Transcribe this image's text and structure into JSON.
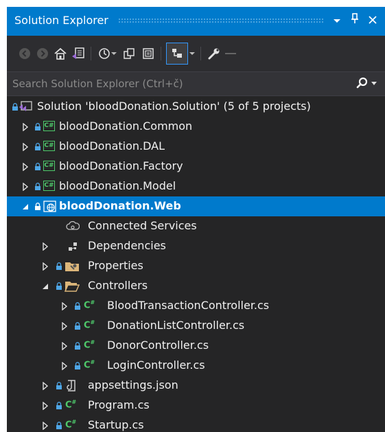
{
  "window": {
    "title": "Solution Explorer"
  },
  "search": {
    "placeholder": "Search Solution Explorer (Ctrl+č)"
  },
  "tree": {
    "solution": "Solution 'bloodDonation.Solution' (5 of 5 projects)",
    "projects": [
      "bloodDonation.Common",
      "bloodDonation.DAL",
      "bloodDonation.Factory",
      "bloodDonation.Model"
    ],
    "web_project": "bloodDonation.Web",
    "web_children": {
      "connected_services": "Connected Services",
      "dependencies": "Dependencies",
      "properties": "Properties",
      "controllers": "Controllers",
      "controller_files": [
        "BloodTransactionController.cs",
        "DonationListController.cs",
        "DonorController.cs",
        "LoginController.cs"
      ],
      "appsettings": "appsettings.json",
      "program": "Program.cs",
      "startup": "Startup.cs"
    }
  },
  "colors": {
    "accent": "#007acc",
    "background": "#252526",
    "csharp": "#4ec96b",
    "lock": "#4ea6e6",
    "folder": "#dcb67a"
  }
}
